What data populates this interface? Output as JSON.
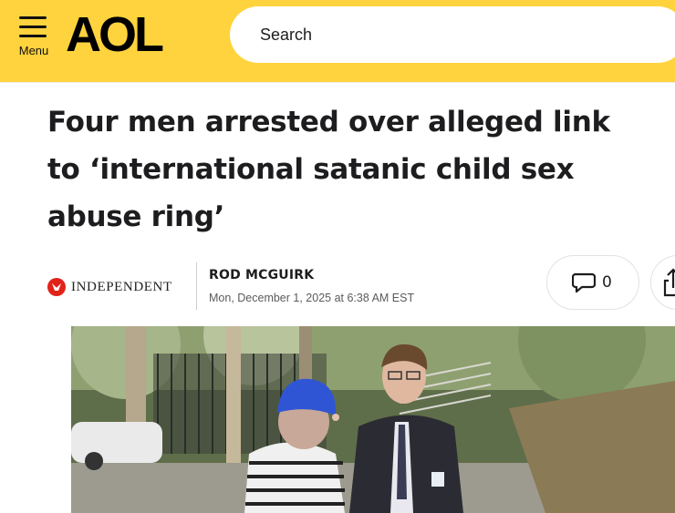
{
  "header": {
    "menu_label": "Menu",
    "logo_text": "AOL",
    "search_placeholder": "Search",
    "bg_color": "#ffd33d"
  },
  "article": {
    "headline": "Four men arrested over alleged link to ‘international satanic child sex abuse ring’",
    "publisher": "INDEPENDENT",
    "author": "ROD MCGUIRK",
    "date": "Mon, December 1, 2025 at 6:38 AM EST",
    "comment_count": "0"
  },
  "icons": {
    "menu": "hamburger-icon",
    "comment": "speech-bubble-icon",
    "share": "share-icon",
    "publisher_logo": "eagle-icon"
  }
}
